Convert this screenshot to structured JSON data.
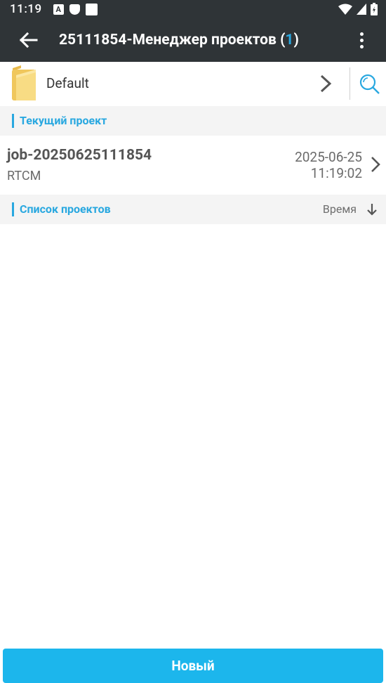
{
  "status_bar": {
    "time": "11:19",
    "notification_icons": [
      "a-icon",
      "shield-icon",
      "square-icon"
    ],
    "right_icons": [
      "wifi-icon",
      "signal-icon",
      "battery-icon"
    ]
  },
  "app_bar": {
    "title_prefix": "25111854-Менеджер проектов (",
    "count": "1",
    "title_suffix": ")",
    "back_icon": "arrow-left-icon",
    "menu_icon": "more-vert-icon"
  },
  "folder": {
    "name": "Default",
    "icon": "folder-icon"
  },
  "current_project_section": {
    "label": "Текущий проект"
  },
  "current_project": {
    "name": "job-20250625111854",
    "type": "RTCM",
    "date": "2025-06-25",
    "time": "11:19:02"
  },
  "project_list_section": {
    "label": "Список проектов",
    "sort_label": "Время"
  },
  "footer": {
    "new_button_label": "Новый"
  },
  "colors": {
    "app_bar": "#2f3437",
    "accent": "#29a8e0",
    "button": "#1cb6ec",
    "section_bg": "#f4f4f4"
  }
}
